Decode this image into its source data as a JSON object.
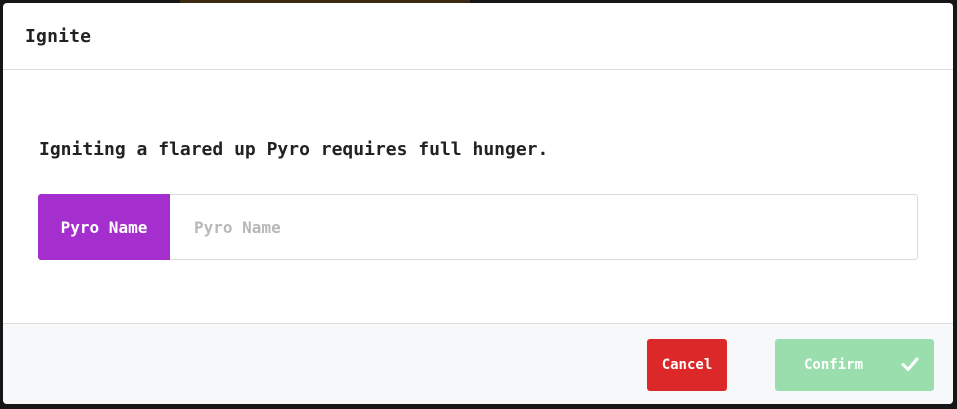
{
  "modal": {
    "title": "Ignite",
    "message": "Igniting a flared up Pyro requires full hunger.",
    "input": {
      "addon_label": "Pyro Name",
      "placeholder": "Pyro Name",
      "value": ""
    },
    "buttons": {
      "cancel_label": "Cancel",
      "confirm_label": "Confirm",
      "confirm_icon": "checkmark-icon"
    }
  },
  "colors": {
    "addon_bg": "#a52fce",
    "cancel_bg": "#dc2828",
    "confirm_bg_disabled": "#9bdeae",
    "footer_bg": "#f7f8fa"
  }
}
